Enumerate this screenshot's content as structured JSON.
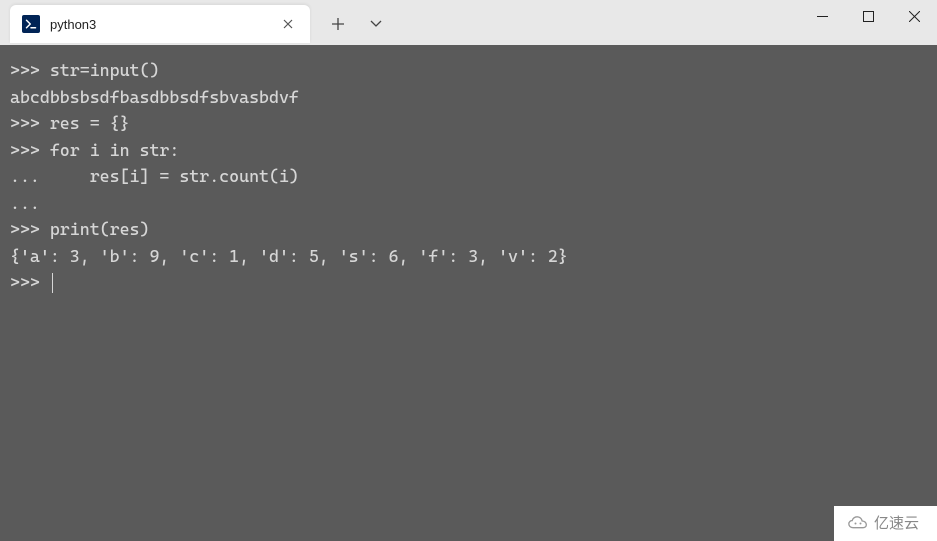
{
  "window": {
    "tab_title": "python3",
    "controls": {
      "minimize": "—",
      "maximize": "□",
      "close": "✕"
    },
    "tab_close": "✕",
    "new_tab": "+",
    "dropdown": "⌵"
  },
  "terminal": {
    "lines": [
      ">>> str=input()",
      "abcdbbsbsdfbasdbbsdfsbvasbdvf",
      ">>> res = {}",
      ">>> for i in str:",
      "...     res[i] = str.count(i)",
      "...",
      ">>> print(res)",
      "{'a': 3, 'b': 9, 'c': 1, 'd': 5, 's': 6, 'f': 3, 'v': 2}",
      ">>> "
    ]
  },
  "watermark": {
    "text": "亿速云"
  }
}
